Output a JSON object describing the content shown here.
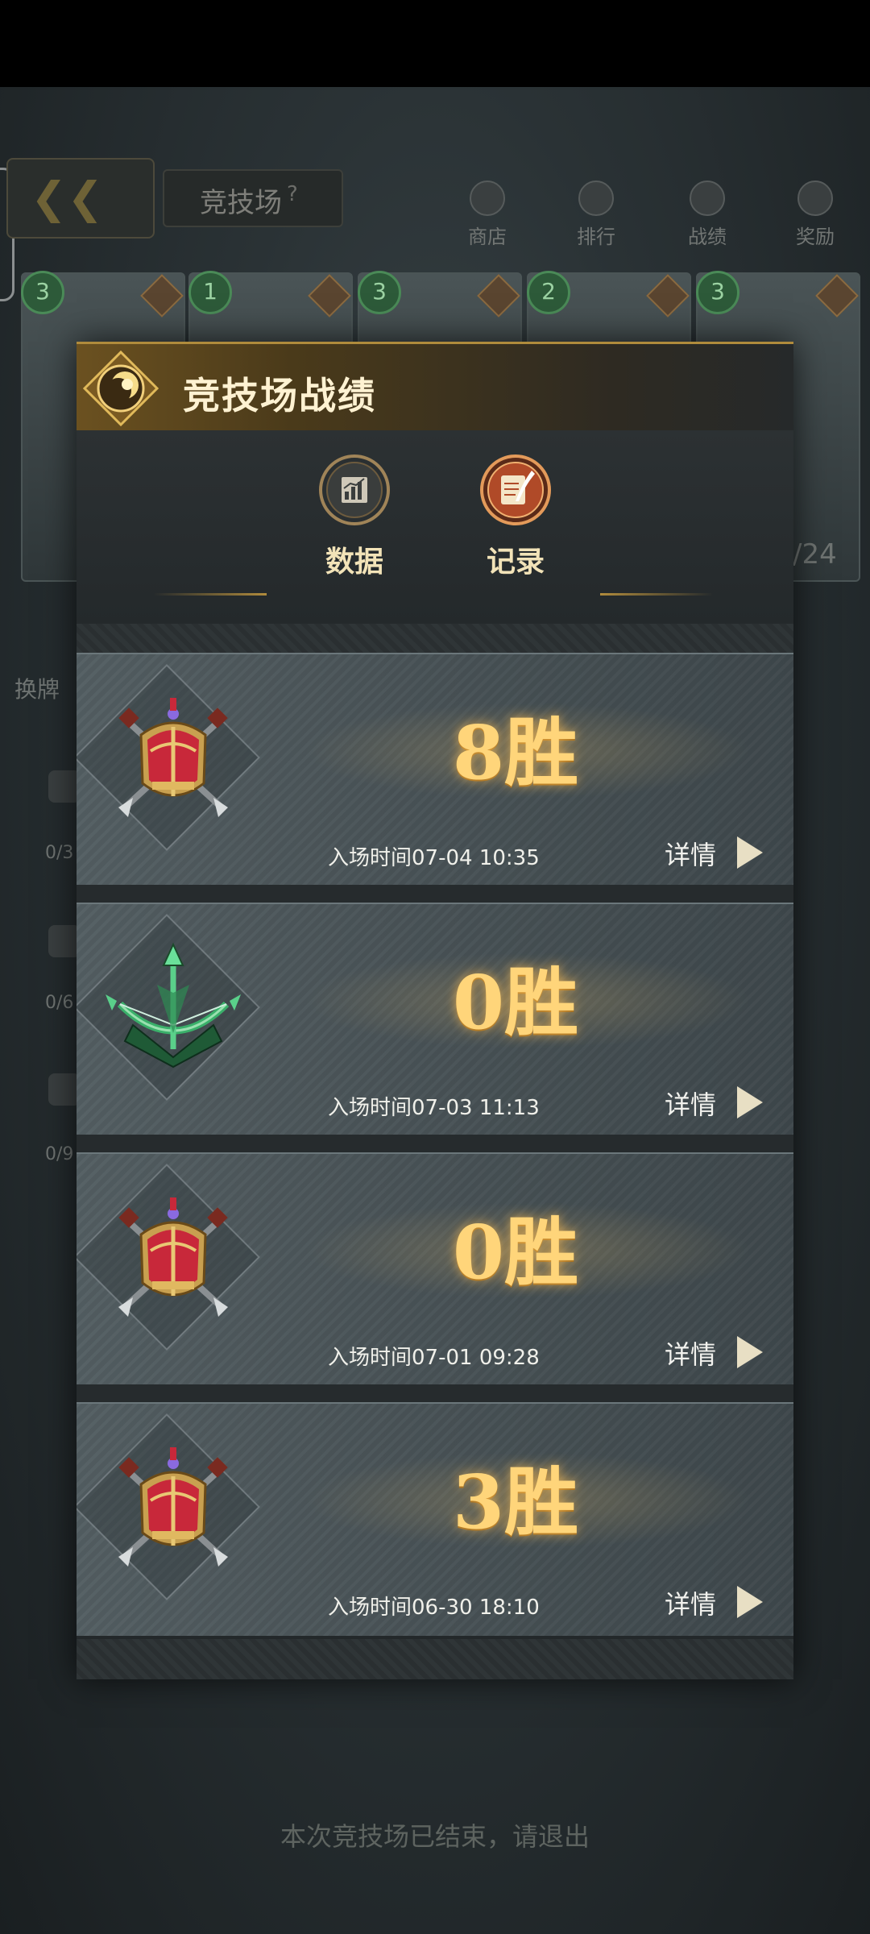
{
  "background": {
    "title": "竞技场",
    "title_help": "?",
    "nav": [
      {
        "label": "商店",
        "icon": "shop-icon"
      },
      {
        "label": "排行",
        "icon": "trophy-icon"
      },
      {
        "label": "战绩",
        "icon": "record-icon"
      },
      {
        "label": "奖励",
        "icon": "reward-icon"
      }
    ],
    "card_levels": [
      "3",
      "1",
      "3",
      "2",
      "3"
    ],
    "side_label": "换牌",
    "counts": [
      "0/3",
      "0/6",
      "0/9"
    ],
    "progress": "/24",
    "ended_notice": "本次竞技场已结束，请退出"
  },
  "modal": {
    "title": "竞技场战绩",
    "tabs": [
      {
        "label": "数据",
        "icon": "stats-chart-icon",
        "active": false
      },
      {
        "label": "记录",
        "icon": "scroll-quill-icon",
        "active": true
      }
    ],
    "records": [
      {
        "wins": "8胜",
        "entry_time": "入场时间07-04 10:35",
        "detail": "详情",
        "badge": "red-crest-badge"
      },
      {
        "wins": "0胜",
        "entry_time": "入场时间07-03 11:13",
        "detail": "详情",
        "badge": "green-crossbow-badge"
      },
      {
        "wins": "0胜",
        "entry_time": "入场时间07-01 09:28",
        "detail": "详情",
        "badge": "red-crest-badge"
      },
      {
        "wins": "3胜",
        "entry_time": "入场时间06-30 18:10",
        "detail": "详情",
        "badge": "red-crest-badge"
      }
    ]
  },
  "colors": {
    "gold_text": "#ffd57a",
    "header_gold": "#b08b3c",
    "panel_dark": "#23282a"
  }
}
